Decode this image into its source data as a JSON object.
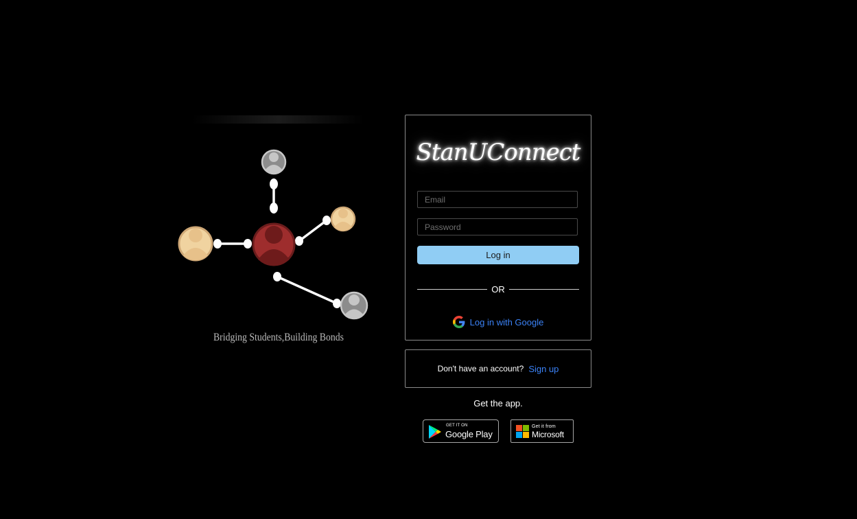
{
  "hero": {
    "tagline": "Bridging Students,Building Bonds",
    "colors": {
      "center": "#9e2d2d",
      "tan": "#f0d3a0",
      "gray": "#a9a9a9"
    }
  },
  "login": {
    "logo_text": "StanUConnect",
    "email_placeholder": "Email",
    "password_placeholder": "Password",
    "login_label": "Log in",
    "divider_label": "OR",
    "google_label": "Log in with Google"
  },
  "signup": {
    "prompt": "Don't have an account?",
    "link_label": "Sign up"
  },
  "get_app": {
    "label": "Get the app.",
    "google_play": {
      "small": "GET IT ON",
      "big": "Google Play"
    },
    "microsoft": {
      "small": "Get it from",
      "big": "Microsoft"
    }
  },
  "colors": {
    "background": "#000000",
    "accent": "#90cdf4",
    "link": "#3b82f6"
  }
}
